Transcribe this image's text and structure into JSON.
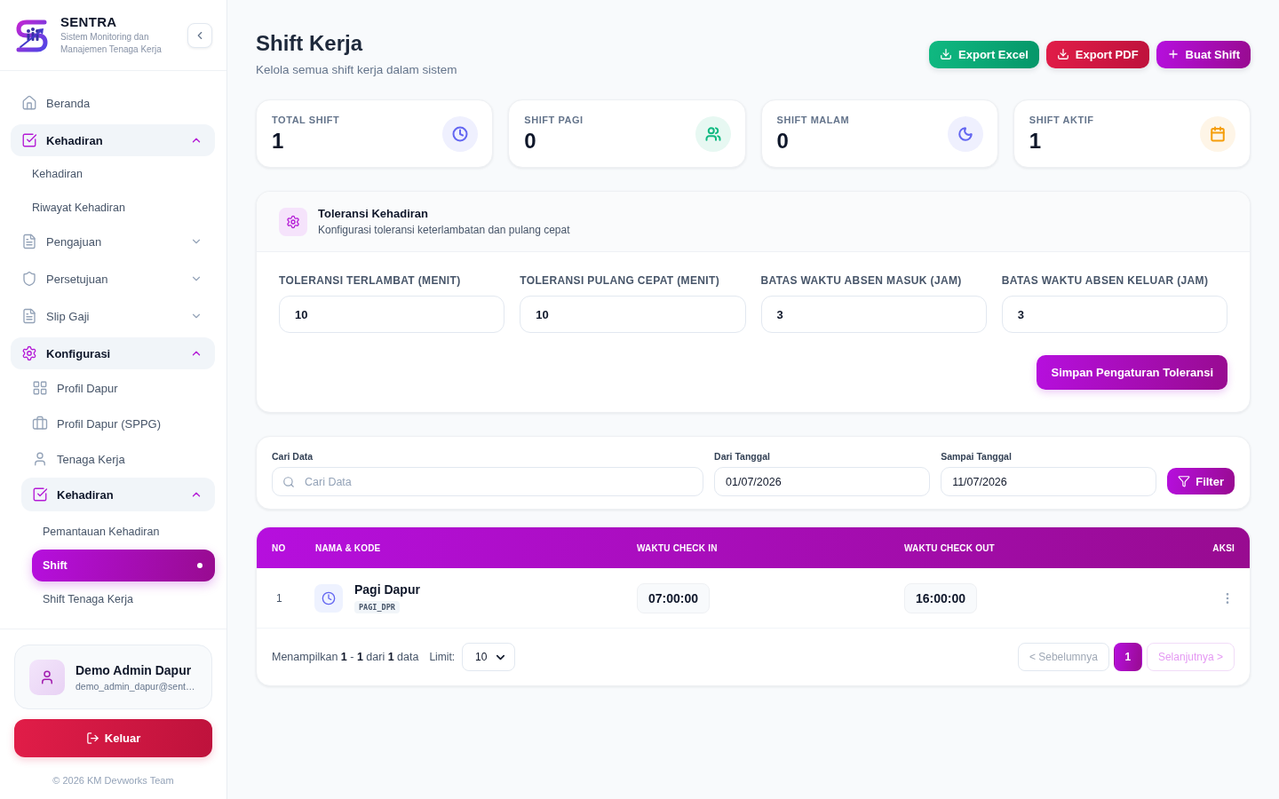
{
  "sidebar": {
    "brand": {
      "name": "SENTRA",
      "tagline": "Sistem Monitoring dan Manajemen Tenaga Kerja"
    },
    "nav": [
      {
        "label": "Beranda",
        "kind": "link",
        "selected": false
      },
      {
        "label": "Kehadiran",
        "kind": "group",
        "expanded": true,
        "children": [
          {
            "label": "Kehadiran",
            "kind": "link",
            "selected": false
          },
          {
            "label": "Riwayat Kehadiran",
            "kind": "link",
            "selected": false
          }
        ]
      },
      {
        "label": "Pengajuan",
        "kind": "group",
        "expanded": false
      },
      {
        "label": "Persetujuan",
        "kind": "group",
        "expanded": false
      },
      {
        "label": "Slip Gaji",
        "kind": "group",
        "expanded": false
      },
      {
        "label": "Konfigurasi",
        "kind": "group",
        "expanded": true,
        "children": [
          {
            "label": "Profil Dapur",
            "kind": "link",
            "selected": false
          },
          {
            "label": "Profil Dapur (SPPG)",
            "kind": "link",
            "selected": false
          },
          {
            "label": "Tenaga Kerja",
            "kind": "link",
            "selected": false
          },
          {
            "label": "Kehadiran",
            "kind": "group",
            "expanded": true,
            "children": [
              {
                "label": "Pemantauan Kehadiran",
                "kind": "link",
                "selected": false
              },
              {
                "label": "Shift",
                "kind": "link",
                "selected": true
              },
              {
                "label": "Shift Tenaga Kerja",
                "kind": "link",
                "selected": false
              }
            ]
          }
        ]
      }
    ],
    "user": {
      "name": "Demo Admin Dapur",
      "email": "demo_admin_dapur@sent…"
    },
    "logout_button": "Keluar",
    "footer": "© 2026 KM Devworks Team"
  },
  "header": {
    "title": "Shift Kerja",
    "subtitle": "Kelola semua shift kerja dalam sistem",
    "actions": [
      {
        "label": "Export Excel",
        "kind": "excel"
      },
      {
        "label": "Export PDF",
        "kind": "pdf"
      },
      {
        "label": "Buat Shift",
        "kind": "create"
      }
    ]
  },
  "stats": [
    {
      "label": "TOTAL SHIFT",
      "value": "1",
      "color": "#6366f1"
    },
    {
      "label": "SHIFT PAGI",
      "value": "0",
      "color": "#10b981"
    },
    {
      "label": "SHIFT MALAM",
      "value": "0",
      "color": "#6366f1"
    },
    {
      "label": "SHIFT AKTIF",
      "value": "1",
      "color": "#f59e0b"
    }
  ],
  "tolerance": {
    "title": "Toleransi Kehadiran",
    "subtitle": "Konfigurasi toleransi keterlambatan dan pulang cepat",
    "fields": [
      {
        "label": "TOLERANSI TERLAMBAT (MENIT)",
        "value": "10"
      },
      {
        "label": "TOLERANSI PULANG CEPAT (MENIT)",
        "value": "10"
      },
      {
        "label": "BATAS WAKTU ABSEN MASUK (JAM)",
        "value": "3"
      },
      {
        "label": "BATAS WAKTU ABSEN KELUAR (JAM)",
        "value": "3"
      }
    ],
    "save_button": "Simpan Pengaturan Toleransi"
  },
  "filter": {
    "fields": [
      {
        "label": "Cari Data",
        "kind": "search",
        "placeholder": "Cari Data"
      },
      {
        "label": "Dari Tanggal",
        "kind": "date",
        "value": "01/07/2026"
      },
      {
        "label": "Sampai Tanggal",
        "kind": "date",
        "value": "11/07/2026"
      }
    ],
    "button": "Filter"
  },
  "table": {
    "columns": [
      "NO",
      "NAMA & KODE",
      "WAKTU CHECK IN",
      "WAKTU CHECK OUT",
      "AKSI"
    ],
    "rows": [
      {
        "no": "1",
        "name": "Pagi Dapur",
        "code": "PAGI_DPR",
        "check_in": "07:00:00",
        "check_out": "16:00:00"
      }
    ],
    "footer": {
      "summary": "Menampilkan **1** - **1** dari **1** data",
      "limit_label": "Limit:",
      "limit_value": "10",
      "pagination": [
        {
          "label": "< Sebelumnya",
          "kind": "prev",
          "disabled": true
        },
        {
          "label": "1",
          "kind": "page",
          "selected": true
        },
        {
          "label": "Selanjutnya >",
          "kind": "next",
          "disabled": true
        }
      ]
    }
  }
}
